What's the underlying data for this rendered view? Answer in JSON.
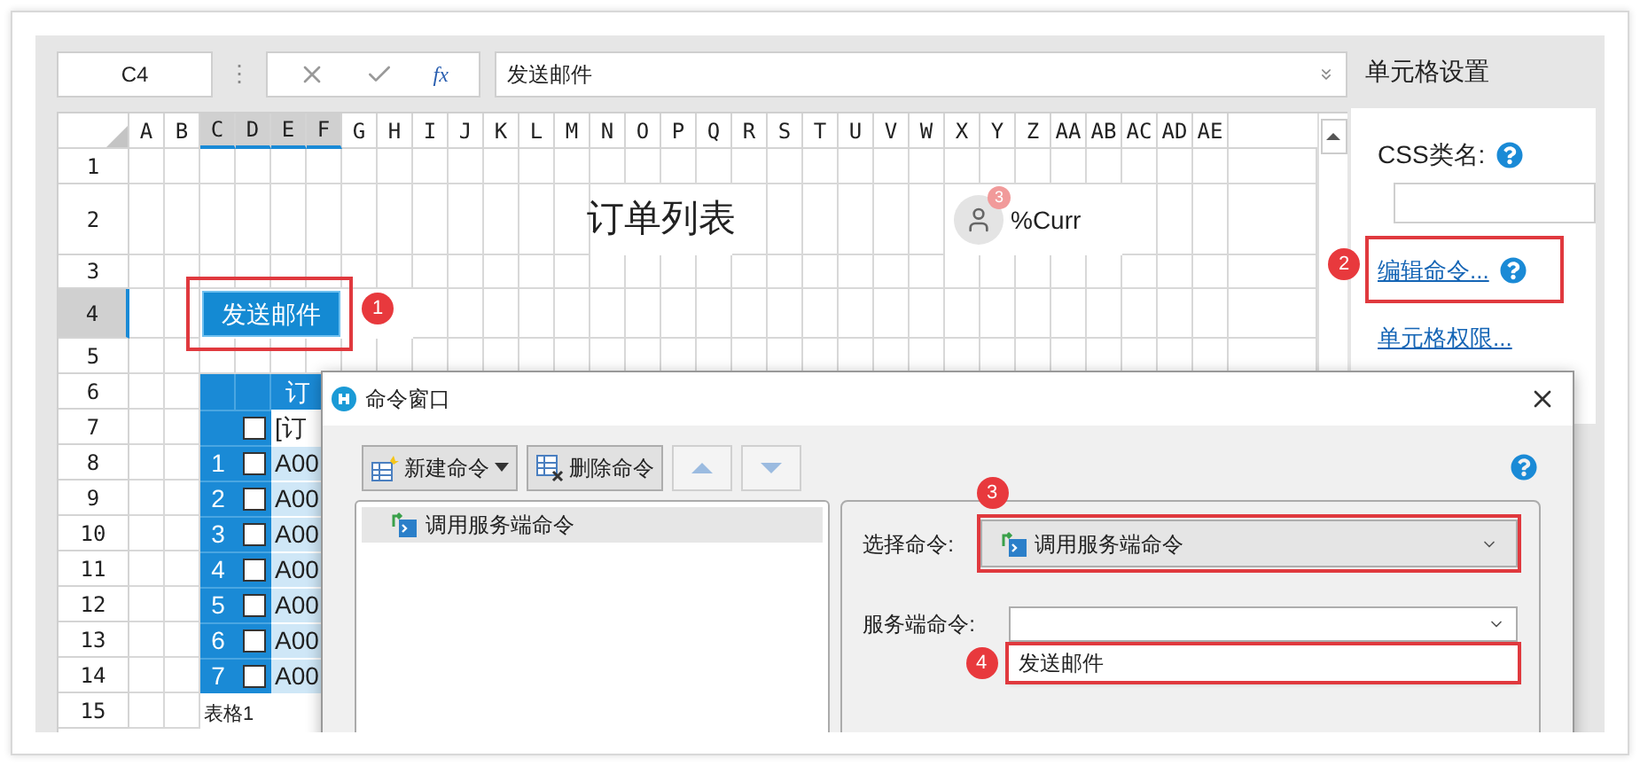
{
  "formula_bar": {
    "cell_ref": "C4",
    "separator": "⋮",
    "function_symbol": "fx",
    "formula": "发送邮件"
  },
  "sheet": {
    "columns": [
      {
        "label": "A",
        "selected": false
      },
      {
        "label": "B",
        "selected": false
      },
      {
        "label": "C",
        "selected": true
      },
      {
        "label": "D",
        "selected": true
      },
      {
        "label": "E",
        "selected": true
      },
      {
        "label": "F",
        "selected": true
      },
      {
        "label": "G",
        "selected": false
      },
      {
        "label": "H",
        "selected": false
      },
      {
        "label": "I",
        "selected": false
      },
      {
        "label": "J",
        "selected": false
      },
      {
        "label": "K",
        "selected": false
      },
      {
        "label": "L",
        "selected": false
      },
      {
        "label": "M",
        "selected": false
      },
      {
        "label": "N",
        "selected": false
      },
      {
        "label": "O",
        "selected": false
      },
      {
        "label": "P",
        "selected": false
      },
      {
        "label": "Q",
        "selected": false
      },
      {
        "label": "R",
        "selected": false
      },
      {
        "label": "S",
        "selected": false
      },
      {
        "label": "T",
        "selected": false
      },
      {
        "label": "U",
        "selected": false
      },
      {
        "label": "V",
        "selected": false
      },
      {
        "label": "W",
        "selected": false
      },
      {
        "label": "X",
        "selected": false
      },
      {
        "label": "Y",
        "selected": false
      },
      {
        "label": "Z",
        "selected": false
      },
      {
        "label": "AA",
        "selected": false
      },
      {
        "label": "AB",
        "selected": false
      },
      {
        "label": "AC",
        "selected": false
      },
      {
        "label": "AD",
        "selected": false
      },
      {
        "label": "AE",
        "selected": false
      }
    ],
    "rows": [
      {
        "label": "1",
        "selected": false
      },
      {
        "label": "2",
        "selected": false
      },
      {
        "label": "3",
        "selected": false
      },
      {
        "label": "4",
        "selected": true
      },
      {
        "label": "5",
        "selected": false
      },
      {
        "label": "6",
        "selected": false
      },
      {
        "label": "7",
        "selected": false
      },
      {
        "label": "8",
        "selected": false
      },
      {
        "label": "9",
        "selected": false
      },
      {
        "label": "10",
        "selected": false
      },
      {
        "label": "11",
        "selected": false
      },
      {
        "label": "12",
        "selected": false
      },
      {
        "label": "13",
        "selected": false
      },
      {
        "label": "14",
        "selected": false
      },
      {
        "label": "15",
        "selected": false
      }
    ],
    "title": "订单列表",
    "user": {
      "badge": "3",
      "text": "%Curr"
    },
    "button": {
      "label": "发送邮件"
    },
    "table": {
      "header": "订",
      "filter": "[订",
      "header_checked": false,
      "rows": [
        {
          "index": "1",
          "checked": false,
          "value": "A00"
        },
        {
          "index": "2",
          "checked": false,
          "value": "A00"
        },
        {
          "index": "3",
          "checked": false,
          "value": "A00"
        },
        {
          "index": "4",
          "checked": false,
          "value": "A00"
        },
        {
          "index": "5",
          "checked": false,
          "value": "A00"
        },
        {
          "index": "6",
          "checked": false,
          "value": "A00"
        },
        {
          "index": "7",
          "checked": false,
          "value": "A00"
        }
      ],
      "name": "表格1"
    }
  },
  "settings_panel": {
    "title": "单元格设置",
    "css_label": "CSS类名:",
    "edit_command_link": "编辑命令...",
    "permissions_link": "单元格权限..."
  },
  "dialog": {
    "title": "命令窗口",
    "new_button": "新建命令",
    "delete_button": "删除命令",
    "commands": [
      {
        "label": "调用服务端命令",
        "selected": true
      }
    ],
    "select_command": {
      "label": "选择命令:",
      "value": "调用服务端命令"
    },
    "server_command": {
      "label": "服务端命令:",
      "option": "发送邮件"
    }
  },
  "annotations": [
    {
      "number": "1"
    },
    {
      "number": "2"
    },
    {
      "number": "3"
    },
    {
      "number": "4"
    }
  ]
}
